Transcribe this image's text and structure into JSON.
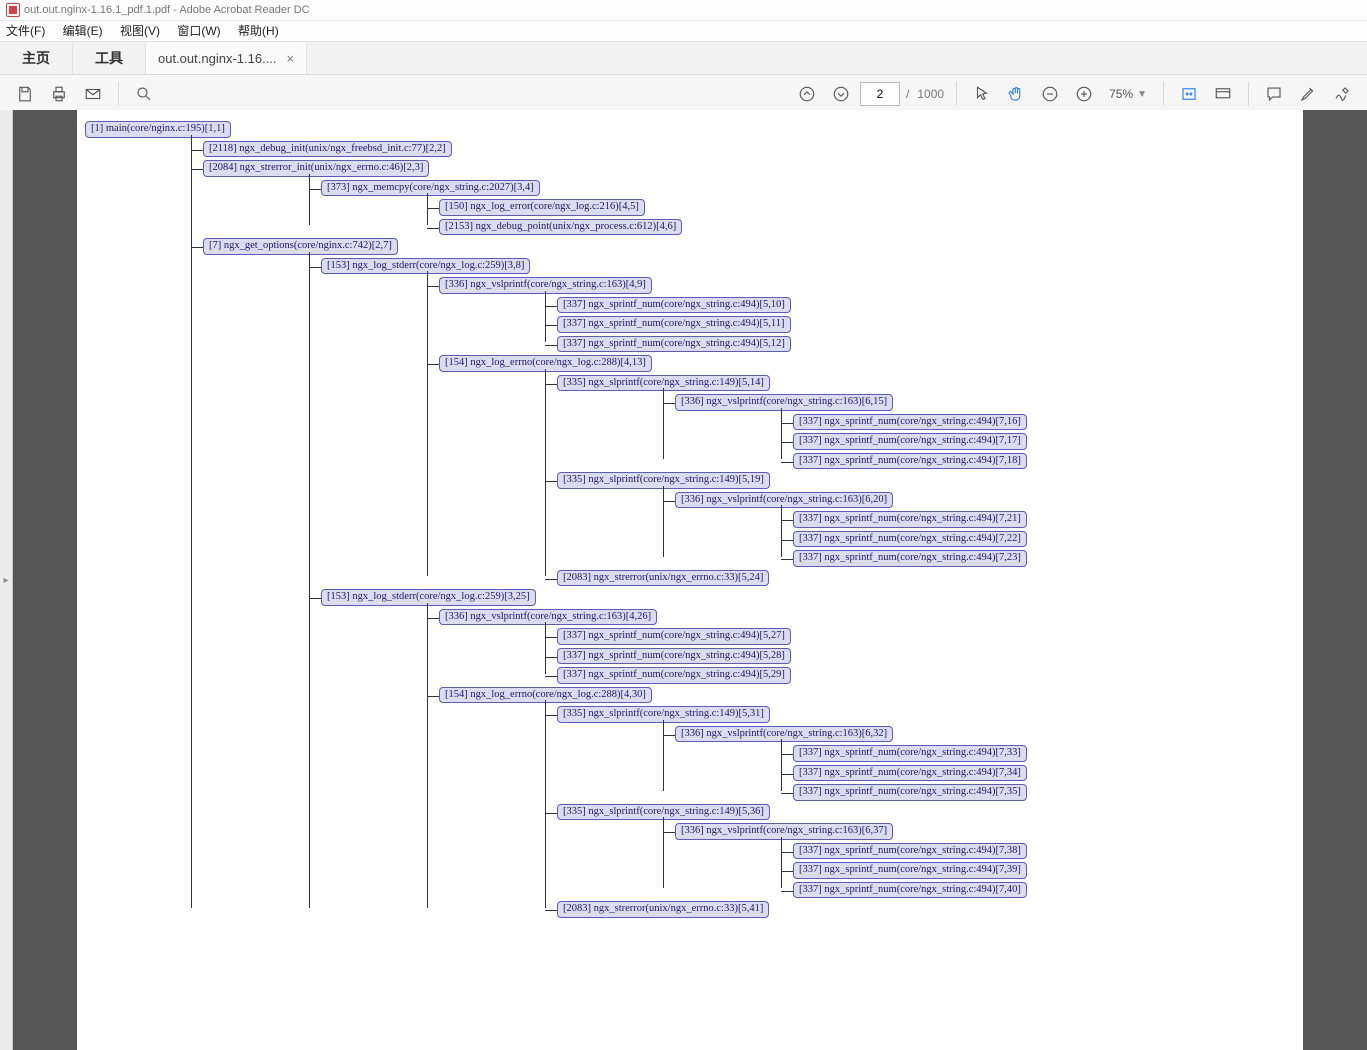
{
  "window": {
    "title": "out.out.nginx-1.16.1_pdf.1.pdf - Adobe Acrobat Reader DC"
  },
  "menu": {
    "file": "文件(F)",
    "edit": "编辑(E)",
    "view": "视图(V)",
    "window": "窗口(W)",
    "help": "帮助(H)"
  },
  "tabs": {
    "home": "主页",
    "tools": "工具",
    "doc": "out.out.nginx-1.16....",
    "close": "×"
  },
  "toolbar": {
    "page_current": "2",
    "page_sep": "/",
    "page_total": "1000",
    "zoom": "75%"
  },
  "tree": [
    {
      "t": "[1] main(core/nginx.c:195)[1,1]",
      "c": [
        {
          "t": "[2118] ngx_debug_init(unix/ngx_freebsd_init.c:77)[2,2]"
        },
        {
          "t": "[2084] ngx_strerror_init(unix/ngx_errno.c:46)[2,3]",
          "c": [
            {
              "t": "[373] ngx_memcpy(core/ngx_string.c:2027)[3,4]",
              "c": [
                {
                  "t": "[150] ngx_log_error(core/ngx_log.c:216)[4,5]"
                },
                {
                  "t": "[2153] ngx_debug_point(unix/ngx_process.c:612)[4,6]"
                }
              ]
            }
          ]
        },
        {
          "t": "[7] ngx_get_options(core/nginx.c:742)[2,7]",
          "c": [
            {
              "t": "[153] ngx_log_stderr(core/ngx_log.c:259)[3,8]",
              "c": [
                {
                  "t": "[336] ngx_vslprintf(core/ngx_string.c:163)[4,9]",
                  "c": [
                    {
                      "t": "[337] ngx_sprintf_num(core/ngx_string.c:494)[5,10]"
                    },
                    {
                      "t": "[337] ngx_sprintf_num(core/ngx_string.c:494)[5,11]"
                    },
                    {
                      "t": "[337] ngx_sprintf_num(core/ngx_string.c:494)[5,12]"
                    }
                  ]
                },
                {
                  "t": "[154] ngx_log_errno(core/ngx_log.c:288)[4,13]",
                  "c": [
                    {
                      "t": "[335] ngx_slprintf(core/ngx_string.c:149)[5,14]",
                      "c": [
                        {
                          "t": "[336] ngx_vslprintf(core/ngx_string.c:163)[6,15]",
                          "c": [
                            {
                              "t": "[337] ngx_sprintf_num(core/ngx_string.c:494)[7,16]"
                            },
                            {
                              "t": "[337] ngx_sprintf_num(core/ngx_string.c:494)[7,17]"
                            },
                            {
                              "t": "[337] ngx_sprintf_num(core/ngx_string.c:494)[7,18]"
                            }
                          ]
                        }
                      ]
                    },
                    {
                      "t": "[335] ngx_slprintf(core/ngx_string.c:149)[5,19]",
                      "c": [
                        {
                          "t": "[336] ngx_vslprintf(core/ngx_string.c:163)[6,20]",
                          "c": [
                            {
                              "t": "[337] ngx_sprintf_num(core/ngx_string.c:494)[7,21]"
                            },
                            {
                              "t": "[337] ngx_sprintf_num(core/ngx_string.c:494)[7,22]"
                            },
                            {
                              "t": "[337] ngx_sprintf_num(core/ngx_string.c:494)[7,23]"
                            }
                          ]
                        }
                      ]
                    },
                    {
                      "t": "[2083] ngx_strerror(unix/ngx_errno.c:33)[5,24]"
                    }
                  ]
                }
              ]
            },
            {
              "t": "[153] ngx_log_stderr(core/ngx_log.c:259)[3,25]",
              "c": [
                {
                  "t": "[336] ngx_vslprintf(core/ngx_string.c:163)[4,26]",
                  "c": [
                    {
                      "t": "[337] ngx_sprintf_num(core/ngx_string.c:494)[5,27]"
                    },
                    {
                      "t": "[337] ngx_sprintf_num(core/ngx_string.c:494)[5,28]"
                    },
                    {
                      "t": "[337] ngx_sprintf_num(core/ngx_string.c:494)[5,29]"
                    }
                  ]
                },
                {
                  "t": "[154] ngx_log_errno(core/ngx_log.c:288)[4,30]",
                  "c": [
                    {
                      "t": "[335] ngx_slprintf(core/ngx_string.c:149)[5,31]",
                      "c": [
                        {
                          "t": "[336] ngx_vslprintf(core/ngx_string.c:163)[6,32]",
                          "c": [
                            {
                              "t": "[337] ngx_sprintf_num(core/ngx_string.c:494)[7,33]"
                            },
                            {
                              "t": "[337] ngx_sprintf_num(core/ngx_string.c:494)[7,34]"
                            },
                            {
                              "t": "[337] ngx_sprintf_num(core/ngx_string.c:494)[7,35]"
                            }
                          ]
                        }
                      ]
                    },
                    {
                      "t": "[335] ngx_slprintf(core/ngx_string.c:149)[5,36]",
                      "c": [
                        {
                          "t": "[336] ngx_vslprintf(core/ngx_string.c:163)[6,37]",
                          "c": [
                            {
                              "t": "[337] ngx_sprintf_num(core/ngx_string.c:494)[7,38]"
                            },
                            {
                              "t": "[337] ngx_sprintf_num(core/ngx_string.c:494)[7,39]"
                            },
                            {
                              "t": "[337] ngx_sprintf_num(core/ngx_string.c:494)[7,40]"
                            }
                          ]
                        }
                      ]
                    },
                    {
                      "t": "[2083] ngx_strerror(unix/ngx_errno.c:33)[5,41]"
                    }
                  ]
                }
              ]
            }
          ]
        }
      ]
    }
  ]
}
